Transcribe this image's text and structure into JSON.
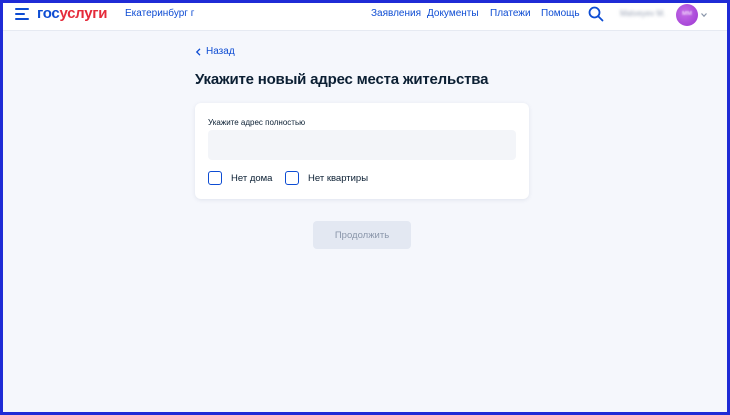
{
  "header": {
    "logo_part1": "гос",
    "logo_part2": "услуги",
    "city": "Екатеринбург г",
    "nav": [
      "Заявления",
      "Документы",
      "Платежи",
      "Помощь"
    ],
    "user_name": "Matveyev M.",
    "avatar_initials": "MM"
  },
  "colors": {
    "brand_blue": "#0d4cd3",
    "brand_red": "#e52a3a",
    "avatar": "#b04fe0",
    "frame": "#1f2bd6"
  },
  "icons": [
    "menu-icon",
    "search-icon",
    "chevron-left-icon",
    "chevron-down-icon"
  ],
  "page": {
    "back_label": "Назад",
    "title": "Укажите новый адрес места жительства"
  },
  "form": {
    "address_label": "Укажите адрес полностью",
    "address_value": "",
    "checkboxes": [
      {
        "label": "Нет дома",
        "checked": false
      },
      {
        "label": "Нет квартиры",
        "checked": false
      }
    ],
    "continue_label": "Продолжить"
  }
}
